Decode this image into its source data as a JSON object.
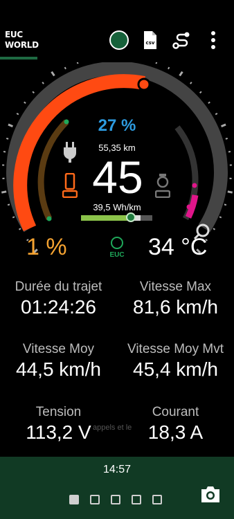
{
  "app": {
    "logo_line1": "EUC",
    "logo_line2": "WORLD",
    "toolbar": {
      "status_icon": "connection-status-icon",
      "csv_icon": "csv-file-icon",
      "csv_label": "csv",
      "route_icon": "route-icon",
      "menu_icon": "more-vert-icon"
    }
  },
  "gauge": {
    "battery_center": "27 %",
    "distance": "55,35 km",
    "speed": "45",
    "consumption": "39,5 Wh/km",
    "consumption_level": 0.66,
    "battery_left": "1 %",
    "temperature": "34 °C",
    "euc_label": "EUC",
    "colors": {
      "speed_arc": "#ff4a12",
      "battery_arc": "#f5a331",
      "consumption_bar": "#8bc34a",
      "accent_green": "#1fa85a",
      "temp_arc": "#e0158a"
    }
  },
  "stats": {
    "trip_duration_label": "Durée du trajet",
    "trip_duration_value": "01:24:26",
    "max_speed_label": "Vitesse Max",
    "max_speed_value": "81,6 km/h",
    "avg_speed_label": "Vitesse Moy",
    "avg_speed_value": "44,5 km/h",
    "avg_moving_speed_label": "Vitesse Moy Mvt",
    "avg_moving_speed_value": "45,4 km/h",
    "voltage_label": "Tension",
    "voltage_value": "113,2 V",
    "current_label": "Courant",
    "current_value": "18,3 A",
    "overlay_text": "appels et le"
  },
  "footer": {
    "time": "14:57",
    "page_count": 5,
    "active_page": 1,
    "camera_icon": "camera-icon"
  }
}
